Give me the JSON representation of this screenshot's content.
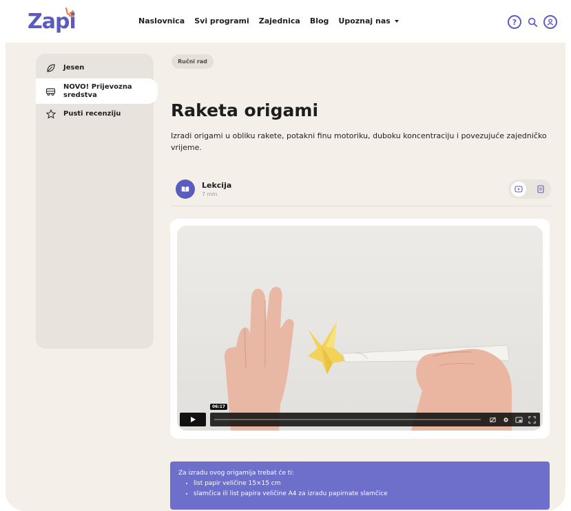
{
  "brand": {
    "logo_text": "Zapi",
    "accent": "#5a5cc0",
    "spark_color": "#f07a3c"
  },
  "nav": {
    "items": [
      {
        "label": "Naslovnica"
      },
      {
        "label": "Svi programi"
      },
      {
        "label": "Zajednica"
      },
      {
        "label": "Blog"
      },
      {
        "label": "Upoznaj nas"
      }
    ]
  },
  "header_icons": [
    "help-icon",
    "search-icon",
    "user-icon"
  ],
  "sidebar": {
    "items": [
      {
        "label": "Jesen",
        "icon": "leaf-icon"
      },
      {
        "label": "NOVO! Prijevozna sredstva",
        "icon": "bus-icon"
      },
      {
        "label": "Pusti recenziju",
        "icon": "star-icon"
      }
    ]
  },
  "content": {
    "tag": "Ručni rad",
    "title": "Raketa origami",
    "description": "Izradi origami u obliku rakete, potakni finu motoriku, duboku koncentraciju i povezujuće zajedničko vrijeme."
  },
  "lesson": {
    "title": "Lekcija",
    "duration": "7 min"
  },
  "video": {
    "time": "06:17"
  },
  "info": {
    "intro": "Za izradu ovog origamija trebat će ti:",
    "items": [
      "list papir veličine 15×15 cm",
      "slamčica ili list papira veličine A4 za izradu papirnate slamčice"
    ]
  }
}
